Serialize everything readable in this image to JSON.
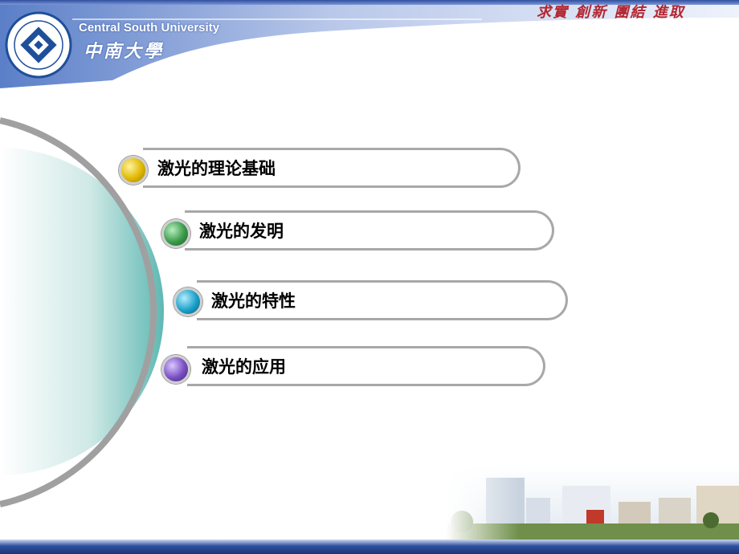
{
  "header": {
    "university_en": "Central South University",
    "university_cn": "中南大學",
    "motto": "求實 創新 團結 進取"
  },
  "menu": [
    {
      "label": "激光的理论基础",
      "color": "#e0b800"
    },
    {
      "label": "激光的发明",
      "color": "#3a9a4a"
    },
    {
      "label": "激光的特性",
      "color": "#1aa0c8"
    },
    {
      "label": "激光的应用",
      "color": "#7a4fc2"
    }
  ]
}
